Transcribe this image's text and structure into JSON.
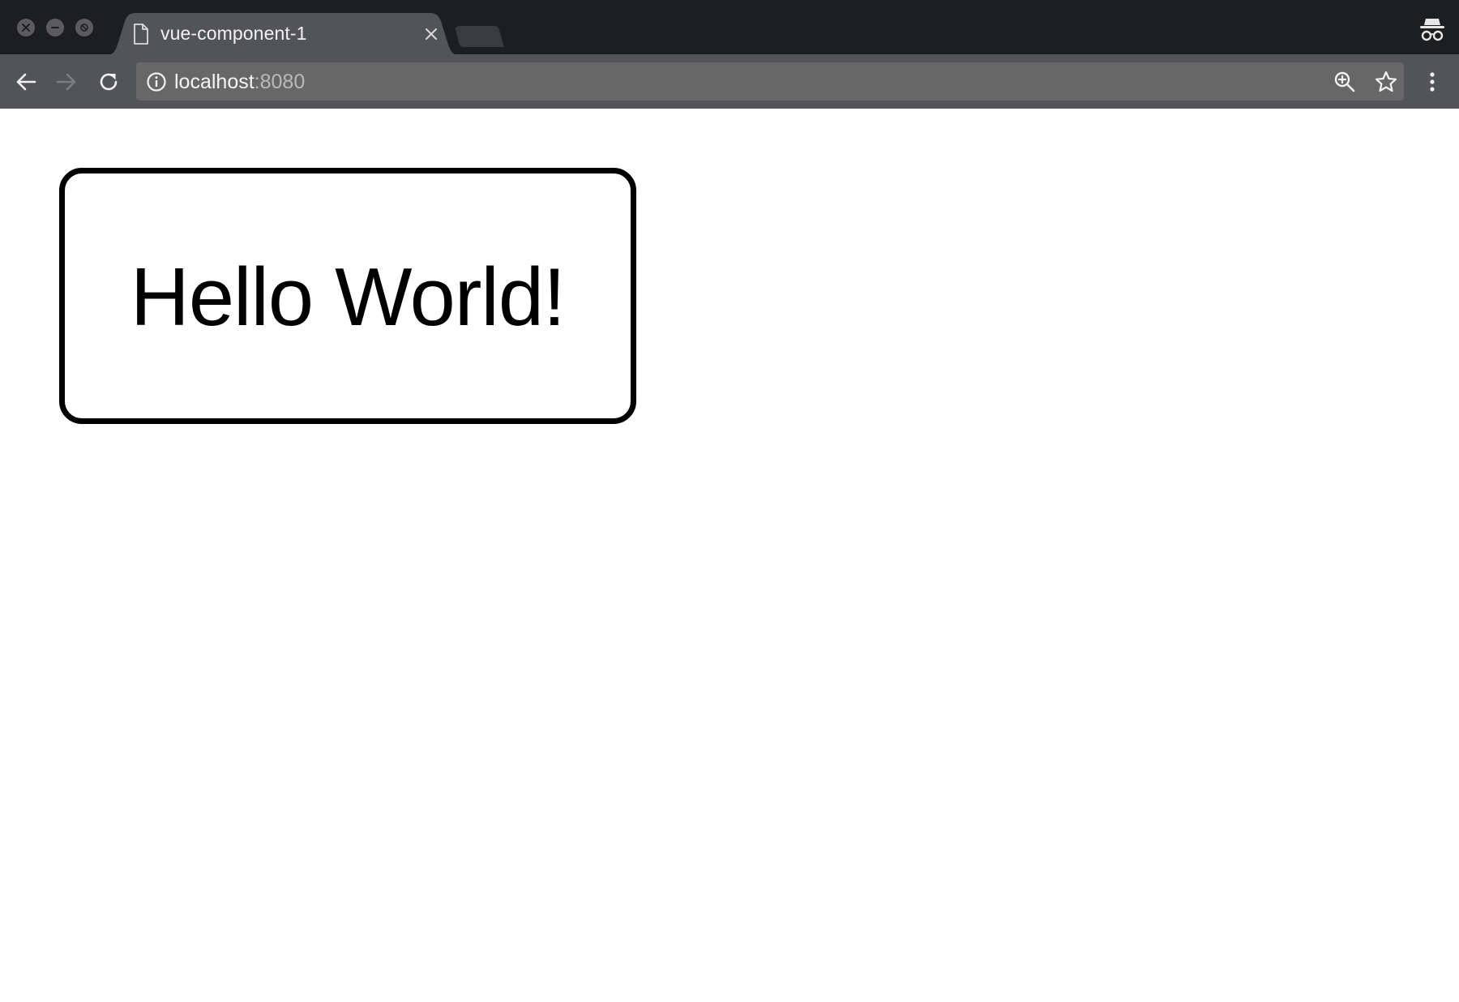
{
  "browser": {
    "colors": {
      "tabstrip": "#1d1e20",
      "active_tab": "#525457",
      "toolbar": "#525457",
      "omnibox": "#676767"
    },
    "tab": {
      "title": "vue-component-1"
    },
    "address_bar": {
      "host": "localhost",
      "port": ":8080"
    }
  },
  "page": {
    "card": {
      "text": "Hello World!"
    }
  }
}
